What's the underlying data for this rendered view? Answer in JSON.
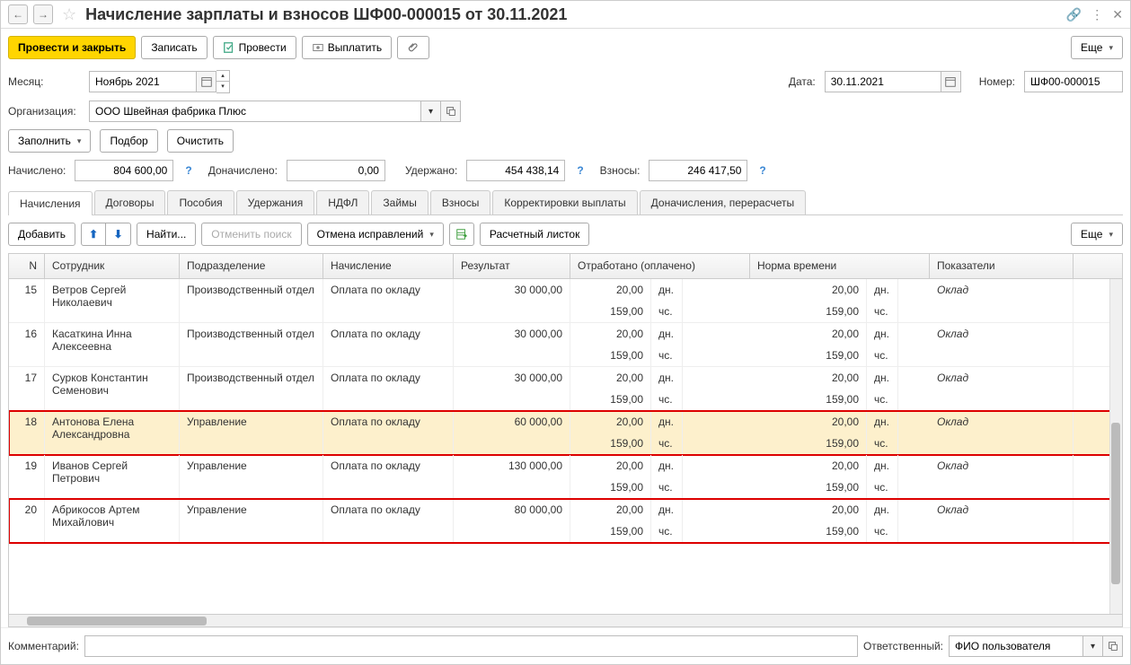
{
  "header": {
    "title": "Начисление зарплаты и взносов ШФ00-000015 от 30.11.2021"
  },
  "toolbar": {
    "post_close": "Провести и закрыть",
    "save": "Записать",
    "post": "Провести",
    "pay": "Выплатить",
    "more": "Еще"
  },
  "fields": {
    "month_label": "Месяц:",
    "month_value": "Ноябрь 2021",
    "date_label": "Дата:",
    "date_value": "30.11.2021",
    "number_label": "Номер:",
    "number_value": "ШФ00-000015",
    "org_label": "Организация:",
    "org_value": "ООО Швейная фабрика Плюс"
  },
  "actions": {
    "fill": "Заполнить",
    "select": "Подбор",
    "clear": "Очистить"
  },
  "sums": {
    "accrued_label": "Начислено:",
    "accrued_value": "804 600,00",
    "additional_label": "Доначислено:",
    "additional_value": "0,00",
    "withheld_label": "Удержано:",
    "withheld_value": "454 438,14",
    "contrib_label": "Взносы:",
    "contrib_value": "246 417,50"
  },
  "tabs": [
    "Начисления",
    "Договоры",
    "Пособия",
    "Удержания",
    "НДФЛ",
    "Займы",
    "Взносы",
    "Корректировки выплаты",
    "Доначисления, перерасчеты"
  ],
  "table_toolbar": {
    "add": "Добавить",
    "find": "Найти...",
    "cancel_find": "Отменить поиск",
    "cancel_fix": "Отмена исправлений",
    "payslip": "Расчетный листок",
    "more": "Еще"
  },
  "columns": {
    "n": "N",
    "employee": "Сотрудник",
    "dept": "Подразделение",
    "accrual": "Начисление",
    "result": "Результат",
    "worked": "Отработано (оплачено)",
    "norm": "Норма времени",
    "indicator": "Показатели"
  },
  "units": {
    "days": "дн.",
    "hours": "чс."
  },
  "rows": [
    {
      "n": "15",
      "emp": "Ветров Сергей Николаевич",
      "dept": "Производственный отдел",
      "accr": "Оплата по окладу",
      "res": "30 000,00",
      "wd": "20,00",
      "wh": "159,00",
      "nd": "20,00",
      "nh": "159,00",
      "ind": "Оклад",
      "selected": false,
      "highlighted": false
    },
    {
      "n": "16",
      "emp": "Касаткина Инна Алексеевна",
      "dept": "Производственный отдел",
      "accr": "Оплата по окладу",
      "res": "30 000,00",
      "wd": "20,00",
      "wh": "159,00",
      "nd": "20,00",
      "nh": "159,00",
      "ind": "Оклад",
      "selected": false,
      "highlighted": false
    },
    {
      "n": "17",
      "emp": "Сурков Константин Семенович",
      "dept": "Производственный отдел",
      "accr": "Оплата по окладу",
      "res": "30 000,00",
      "wd": "20,00",
      "wh": "159,00",
      "nd": "20,00",
      "nh": "159,00",
      "ind": "Оклад",
      "selected": false,
      "highlighted": false
    },
    {
      "n": "18",
      "emp": "Антонова Елена Александровна",
      "dept": "Управление",
      "accr": "Оплата по окладу",
      "res": "60 000,00",
      "wd": "20,00",
      "wh": "159,00",
      "nd": "20,00",
      "nh": "159,00",
      "ind": "Оклад",
      "selected": true,
      "highlighted": true
    },
    {
      "n": "19",
      "emp": "Иванов Сергей Петрович",
      "dept": "Управление",
      "accr": "Оплата по окладу",
      "res": "130 000,00",
      "wd": "20,00",
      "wh": "159,00",
      "nd": "20,00",
      "nh": "159,00",
      "ind": "Оклад",
      "selected": false,
      "highlighted": false
    },
    {
      "n": "20",
      "emp": "Абрикосов Артем Михайлович",
      "dept": "Управление",
      "accr": "Оплата по окладу",
      "res": "80 000,00",
      "wd": "20,00",
      "wh": "159,00",
      "nd": "20,00",
      "nh": "159,00",
      "ind": "Оклад",
      "selected": false,
      "highlighted": true
    }
  ],
  "footer": {
    "comment_label": "Комментарий:",
    "responsible_label": "Ответственный:",
    "responsible_value": "ФИО пользователя"
  }
}
